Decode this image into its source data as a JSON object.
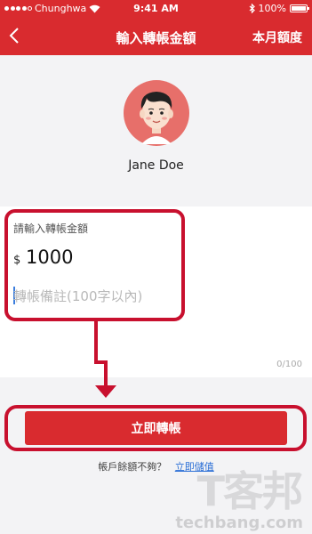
{
  "status_bar": {
    "carrier": "Chunghwa",
    "time": "9:41 AM",
    "battery": "100%"
  },
  "nav": {
    "back_icon": "chevron-left",
    "title": "輸入轉帳金額",
    "right_label": "本月額度"
  },
  "recipient": {
    "name": "Jane Doe",
    "avatar_icon": "person-avatar"
  },
  "amount": {
    "label": "請輸入轉帳金額",
    "currency": "$",
    "value": "1000"
  },
  "memo": {
    "placeholder": "轉帳備註(100字以內)",
    "char_count": "0/100"
  },
  "actions": {
    "transfer_label": "立即轉帳"
  },
  "balance": {
    "prompt": "帳戶餘額不夠？",
    "topup_label": "立即儲值"
  },
  "watermark": {
    "logo": "T客邦",
    "site": "techbang.com"
  },
  "colors": {
    "brand_red": "#d92b2f",
    "annotation_red": "#c8102e",
    "link_blue": "#2b6fd6"
  }
}
